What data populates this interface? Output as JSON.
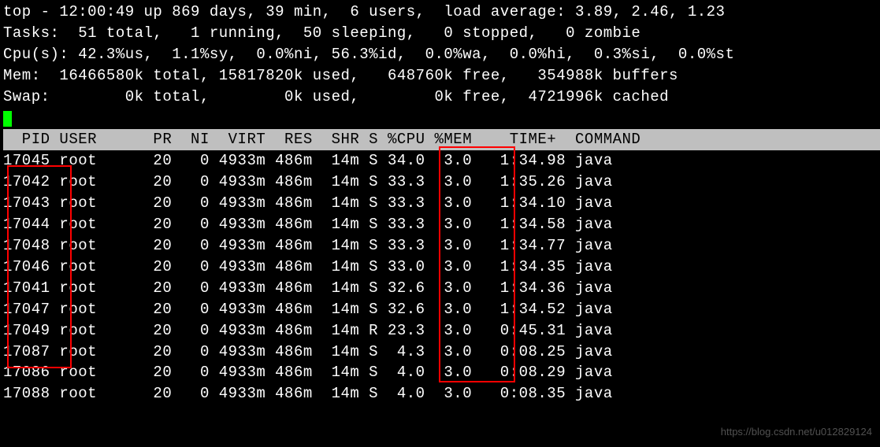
{
  "summary": {
    "line1": "top - 12:00:49 up 869 days, 39 min,  6 users,  load average: 3.89, 2.46, 1.23",
    "line2": "Tasks:  51 total,   1 running,  50 sleeping,   0 stopped,   0 zombie",
    "line3": "Cpu(s): 42.3%us,  1.1%sy,  0.0%ni, 56.3%id,  0.0%wa,  0.0%hi,  0.3%si,  0.0%st",
    "line4": "Mem:  16466580k total, 15817820k used,   648760k free,   354988k buffers",
    "line5": "Swap:        0k total,        0k used,        0k free,  4721996k cached"
  },
  "header": "  PID USER      PR  NI  VIRT  RES  SHR S %CPU %MEM    TIME+  COMMAND           ",
  "rows": [
    "17045 root      20   0 4933m 486m  14m S 34.0  3.0   1:34.98 java",
    "17042 root      20   0 4933m 486m  14m S 33.3  3.0   1:35.26 java",
    "17043 root      20   0 4933m 486m  14m S 33.3  3.0   1:34.10 java",
    "17044 root      20   0 4933m 486m  14m S 33.3  3.0   1:34.58 java",
    "17048 root      20   0 4933m 486m  14m S 33.3  3.0   1:34.77 java",
    "17046 root      20   0 4933m 486m  14m S 33.0  3.0   1:34.35 java",
    "17041 root      20   0 4933m 486m  14m S 32.6  3.0   1:34.36 java",
    "17047 root      20   0 4933m 486m  14m S 32.6  3.0   1:34.52 java",
    "17049 root      20   0 4933m 486m  14m R 23.3  3.0   0:45.31 java",
    "17087 root      20   0 4933m 486m  14m S  4.3  3.0   0:08.25 java",
    "17086 root      20   0 4933m 486m  14m S  4.0  3.0   0:08.29 java",
    "17088 root      20   0 4933m 486m  14m S  4.0  3.0   0:08.35 java"
  ],
  "watermark": "https://blog.csdn.net/u012829124",
  "chart_data": {
    "type": "table",
    "title": "top process list",
    "columns": [
      "PID",
      "USER",
      "PR",
      "NI",
      "VIRT",
      "RES",
      "SHR",
      "S",
      "%CPU",
      "%MEM",
      "TIME+",
      "COMMAND"
    ],
    "data": [
      [
        17045,
        "root",
        20,
        0,
        "4933m",
        "486m",
        "14m",
        "S",
        34.0,
        3.0,
        "1:34.98",
        "java"
      ],
      [
        17042,
        "root",
        20,
        0,
        "4933m",
        "486m",
        "14m",
        "S",
        33.3,
        3.0,
        "1:35.26",
        "java"
      ],
      [
        17043,
        "root",
        20,
        0,
        "4933m",
        "486m",
        "14m",
        "S",
        33.3,
        3.0,
        "1:34.10",
        "java"
      ],
      [
        17044,
        "root",
        20,
        0,
        "4933m",
        "486m",
        "14m",
        "S",
        33.3,
        3.0,
        "1:34.58",
        "java"
      ],
      [
        17048,
        "root",
        20,
        0,
        "4933m",
        "486m",
        "14m",
        "S",
        33.3,
        3.0,
        "1:34.77",
        "java"
      ],
      [
        17046,
        "root",
        20,
        0,
        "4933m",
        "486m",
        "14m",
        "S",
        33.0,
        3.0,
        "1:34.35",
        "java"
      ],
      [
        17041,
        "root",
        20,
        0,
        "4933m",
        "486m",
        "14m",
        "S",
        32.6,
        3.0,
        "1:34.36",
        "java"
      ],
      [
        17047,
        "root",
        20,
        0,
        "4933m",
        "486m",
        "14m",
        "S",
        32.6,
        3.0,
        "1:34.52",
        "java"
      ],
      [
        17049,
        "root",
        20,
        0,
        "4933m",
        "486m",
        "14m",
        "R",
        23.3,
        3.0,
        "0:45.31",
        "java"
      ],
      [
        17087,
        "root",
        20,
        0,
        "4933m",
        "486m",
        "14m",
        "S",
        4.3,
        3.0,
        "0:08.25",
        "java"
      ],
      [
        17086,
        "root",
        20,
        0,
        "4933m",
        "486m",
        "14m",
        "S",
        4.0,
        3.0,
        "0:08.29",
        "java"
      ],
      [
        17088,
        "root",
        20,
        0,
        "4933m",
        "486m",
        "14m",
        "S",
        4.0,
        3.0,
        "0:08.35",
        "java"
      ]
    ]
  }
}
